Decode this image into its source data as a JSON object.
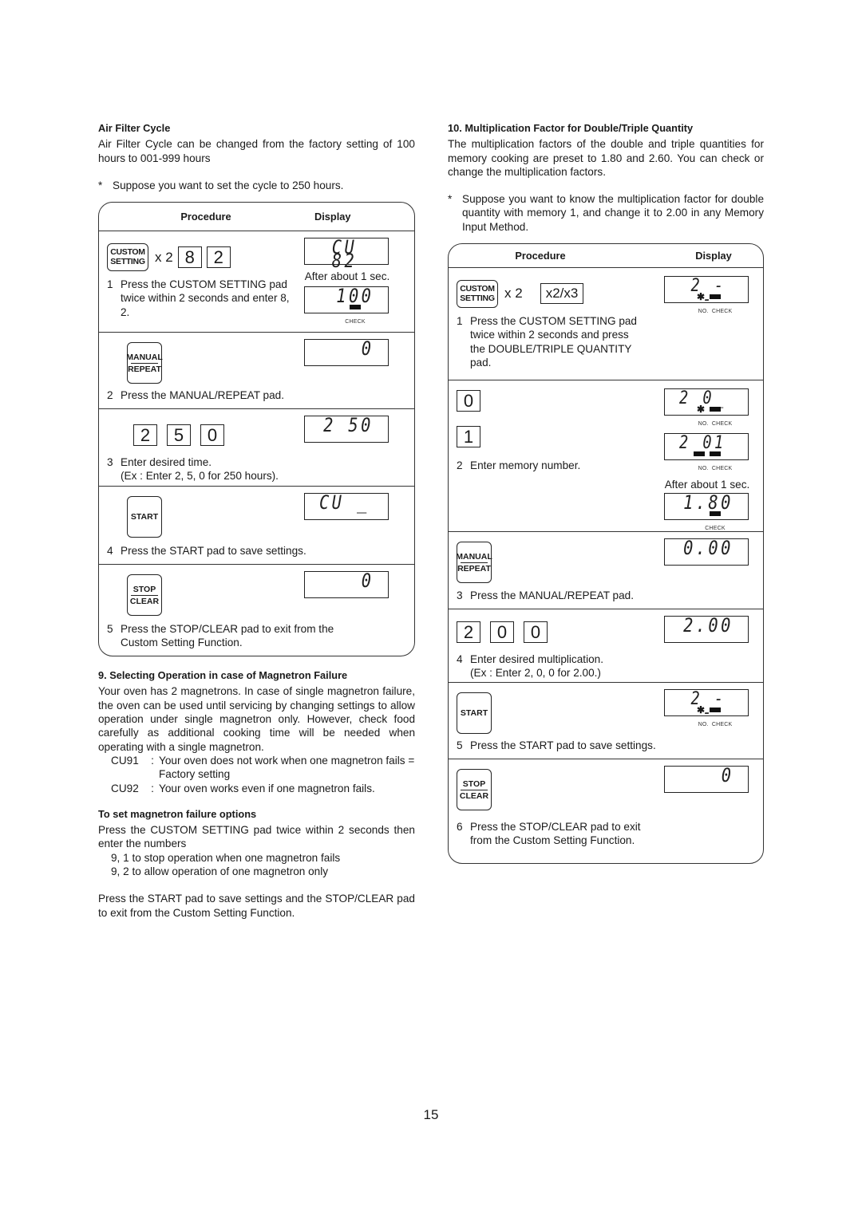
{
  "page_number": "15",
  "left": {
    "air_filter": {
      "heading": "Air Filter Cycle",
      "body": "Air Filter Cycle can be changed from the factory setting of 100 hours to 001-999 hours",
      "note_star": "*",
      "note": "Suppose you want to set the cycle to 250 hours.",
      "table_header": {
        "procedure": "Procedure",
        "display": "Display"
      },
      "steps": [
        {
          "pad": "CUSTOM SETTING",
          "pad_line1": "CUSTOM",
          "pad_line2": "SETTING",
          "times": "x 2",
          "keys": [
            "8",
            "2"
          ],
          "number": "1",
          "text": "Press the CUSTOM SETTING pad twice within 2 seconds and enter 8, 2.",
          "displays": [
            {
              "value": "CU 82"
            },
            {
              "after": "After about 1 sec.",
              "value": "100",
              "indicator": "CHECK"
            }
          ]
        },
        {
          "pad": "MANUAL/REPEAT",
          "pad_line1": "MANUAL",
          "pad_line2": "REPEAT",
          "number": "2",
          "text": "Press the MANUAL/REPEAT pad.",
          "displays": [
            {
              "value": "0"
            }
          ]
        },
        {
          "keys": [
            "2",
            "5",
            "0"
          ],
          "number": "3",
          "text": "Enter desired time.",
          "text2": "(Ex : Enter 2, 5, 0 for 250 hours).",
          "displays": [
            {
              "value": "2 50"
            }
          ]
        },
        {
          "pad": "START",
          "pad_line1": "START",
          "number": "4",
          "text": "Press the START pad to save settings.",
          "displays": [
            {
              "value": "CU _"
            }
          ]
        },
        {
          "pad": "STOP/CLEAR",
          "pad_line1": "STOP",
          "pad_line2": "CLEAR",
          "number": "5",
          "text": "Press the STOP/CLEAR pad to exit from the Custom Setting Function.",
          "displays": [
            {
              "value": "0"
            }
          ]
        }
      ]
    },
    "magnetron": {
      "heading": "9.  Selecting Operation in case of Magnetron Failure",
      "body": "Your oven has 2 magnetrons. In case of single magnetron failure, the oven can be used until servicing by changing settings to allow operation under single magnetron only. However, check food carefully as additional cooking time will be needed when operating with a single magnetron.",
      "options": [
        {
          "code": "CU91",
          "sep": ":",
          "text": "Your oven does not work when one magnetron fails =  Factory setting"
        },
        {
          "code": "CU92",
          "sep": ":",
          "text": "Your oven works even if one magnetron  fails."
        }
      ],
      "sub_heading": "To set magnetron failure options",
      "sub_body": "Press the CUSTOM SETTING pad twice within 2 seconds then enter the numbers",
      "sub_items": [
        "9, 1 to stop operation when one magnetron fails",
        "9, 2 to allow operation of one magnetron only"
      ],
      "closing": "Press the START pad to save settings and the STOP/CLEAR pad to exit from the Custom Setting Function."
    }
  },
  "right": {
    "multiplication": {
      "heading": "10.  Multiplication Factor for Double/Triple Quantity",
      "body": "The multiplication factors of the double and triple quantities for memory cooking are preset to 1.80 and 2.60. You can check or change the multiplication factors.",
      "note_star": "*",
      "note": "Suppose you want to know the multiplication factor for double quantity with memory 1, and change it to 2.00 in any Memory Input Method.",
      "table_header": {
        "procedure": "Procedure",
        "display": "Display"
      },
      "steps": [
        {
          "pad": "CUSTOM SETTING",
          "pad_line1": "CUSTOM",
          "pad_line2": "SETTING",
          "times": "x 2",
          "extra_key": "x2/x3",
          "number": "1",
          "text": "Press the CUSTOM SETTING pad twice within 2 seconds and press the DOUBLE/TRIPLE QUANTITY pad.",
          "displays": [
            {
              "value": "2   - -",
              "indicator_no": "NO.",
              "indicator_check": "CHECK",
              "no_state": "blinking",
              "check_state": "on"
            }
          ]
        },
        {
          "keys": [
            "0",
            "1"
          ],
          "number": "2",
          "text": "Enter memory number.",
          "displays": [
            {
              "value": "2   0_",
              "indicator_no": "NO.",
              "indicator_check": "CHECK",
              "no_state": "blinking",
              "check_state": "on"
            },
            {
              "value": "2   01",
              "indicator_no": "NO.",
              "indicator_check": "CHECK",
              "no_state": "on",
              "check_state": "on"
            },
            {
              "after": "After about 1 sec.",
              "value": "1.80",
              "indicator": "CHECK"
            }
          ]
        },
        {
          "pad": "MANUAL/REPEAT",
          "pad_line1": "MANUAL",
          "pad_line2": "REPEAT",
          "number": "3",
          "text": "Press the MANUAL/REPEAT pad.",
          "displays": [
            {
              "value": "0.00"
            }
          ]
        },
        {
          "keys": [
            "2",
            "0",
            "0"
          ],
          "number": "4",
          "text": "Enter desired multiplication.",
          "text2": "(Ex : Enter 2, 0, 0 for 2.00.)",
          "displays": [
            {
              "value": "2.00"
            }
          ]
        },
        {
          "pad": "START",
          "pad_line1": "START",
          "number": "5",
          "text": "Press the START pad to save settings.",
          "displays": [
            {
              "value": "2   - -",
              "indicator_no": "NO.",
              "indicator_check": "CHECK",
              "no_state": "blinking",
              "check_state": "on"
            }
          ]
        },
        {
          "pad": "STOP/CLEAR",
          "pad_line1": "STOP",
          "pad_line2": "CLEAR",
          "number": "6",
          "text": "Press the STOP/CLEAR pad to exit from the Custom Setting Function.",
          "displays": [
            {
              "value": "0"
            }
          ]
        }
      ]
    }
  }
}
